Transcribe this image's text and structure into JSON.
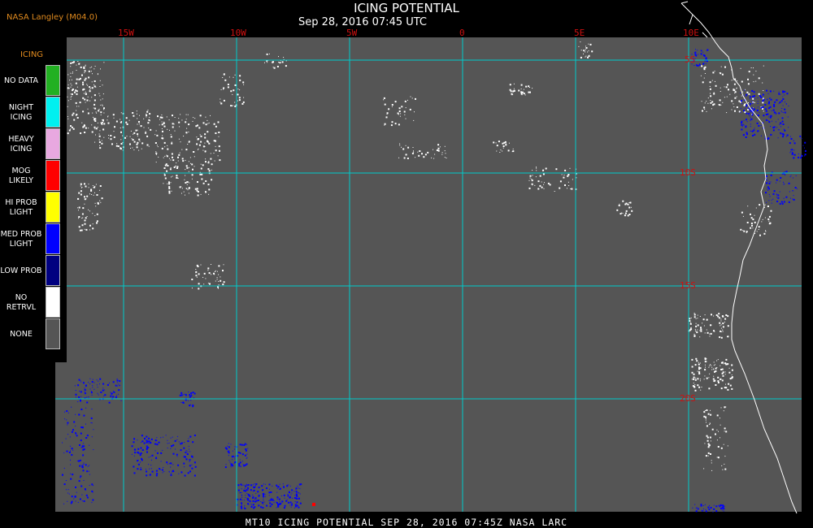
{
  "header": {
    "source": "NASA Langley (M04.0)",
    "title": "ICING POTENTIAL",
    "timestamp": "Sep 28, 2016 07:45 UTC"
  },
  "longitude_labels": [
    "15W",
    "10W",
    "5W",
    "0",
    "5E",
    "10E"
  ],
  "latitude_labels": [
    "5S",
    "10S",
    "15S",
    "20S"
  ],
  "legend": {
    "title": "ICING",
    "items": [
      {
        "label": "NO DATA",
        "color": "#22b022"
      },
      {
        "label": "NIGHT ICING",
        "color": "#00f0f0"
      },
      {
        "label": "HEAVY ICING",
        "color": "#e8a8e0"
      },
      {
        "label": "MOG LIKELY",
        "color": "#ff0000"
      },
      {
        "label": "HI PROB LIGHT",
        "color": "#ffff00"
      },
      {
        "label": "MED PROB LIGHT",
        "color": "#0000ff"
      },
      {
        "label": "LOW PROB",
        "color": "#000080"
      },
      {
        "label": "NO RETRVL",
        "color": "#ffffff"
      },
      {
        "label": "NONE",
        "color": "#555555"
      }
    ]
  },
  "footer": "MT10  ICING POTENTIAL  SEP 28, 2016 07:45Z  NASA LARC",
  "colors": {
    "background": "#555555",
    "grid": "#00cccc",
    "coastline": "#ffffff",
    "label": "#d01010"
  }
}
